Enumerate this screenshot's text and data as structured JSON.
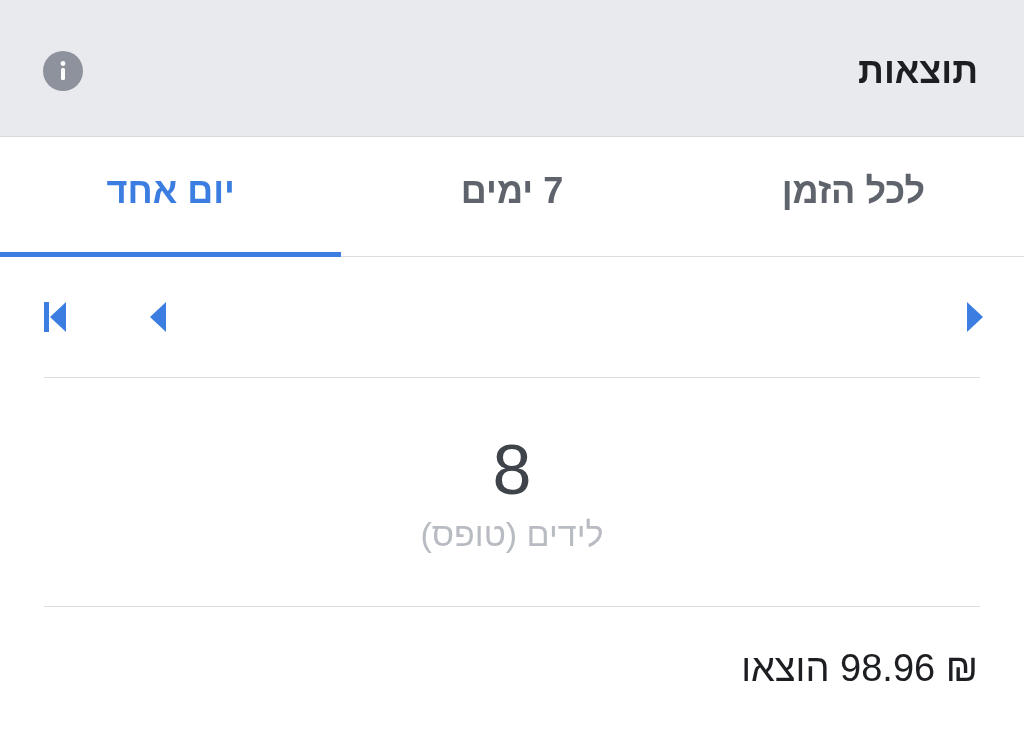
{
  "header": {
    "title": "תוצאות"
  },
  "tabs": [
    {
      "label": "לכל הזמן",
      "selected": false
    },
    {
      "label": "7 ימים",
      "selected": false
    },
    {
      "label": "יום אחד",
      "selected": true
    }
  ],
  "stat": {
    "value": "8",
    "label": "לידים (טופס)"
  },
  "spent": "₪ 98.96 הוצאו"
}
